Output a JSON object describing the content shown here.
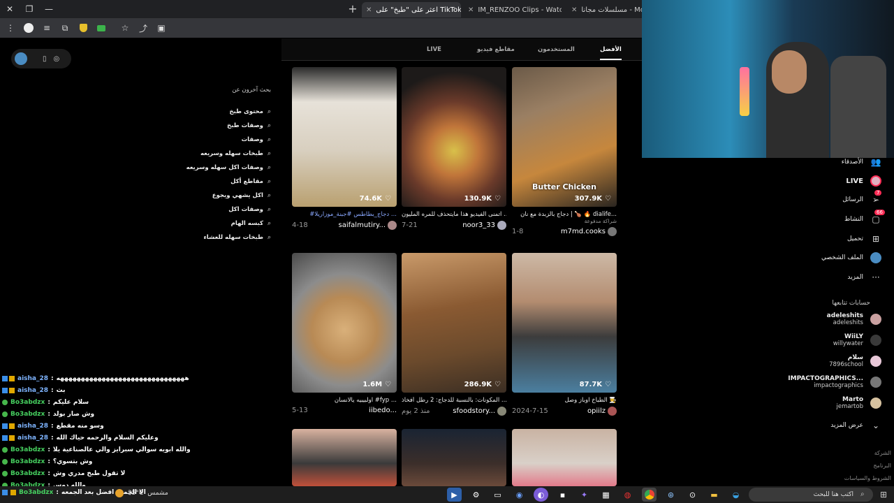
{
  "browser": {
    "tabs": [
      {
        "label": "مسلسلات مجانا - MovieBox"
      },
      {
        "label": "IM_RENZOO Clips - Watch Live"
      },
      {
        "label": "اعثر على \"طبخ\" على TikTok | بحث"
      }
    ],
    "new_tab": "+",
    "close_symbol": "✕"
  },
  "related": {
    "title": "بحث آخرون عن",
    "items": [
      "محتوى طبخ",
      "وصفات طبخ",
      "وصفات",
      "طبخات سهله وسريعه",
      "وصفات اكل سهله وسريعه",
      "مقاطع أكل",
      "اكل يشهي ويجوع",
      "وصفات اكل",
      "كبسه الهام",
      "طبخات سهله للعشاء"
    ]
  },
  "result_tabs": {
    "top": "الأفضل",
    "users": "المستخدمون",
    "videos": "مقاطع فيديو",
    "live": "LIVE"
  },
  "videos": [
    {
      "likes": "307.9K",
      "overlay": "Butter Chicken",
      "desc": "دجاج بالزبدة مع نان | 🍗 🔥 dialife...",
      "sub": "شراكة مدفوعة",
      "user": "m7md.cooks",
      "date": "1-8"
    },
    {
      "likes": "130.9K",
      "overlay": "",
      "desc": "اتمنى الفيديو هذا مايتحذف للمره المليون ...",
      "sub": "",
      "user": "noor3_33",
      "date": "7-21"
    },
    {
      "likes": "74.6K",
      "overlay": "",
      "desc": "#دجاج_بطاطس #جبنة_موزاريلا ...",
      "sub": "",
      "user": "saifalmutiry...",
      "date": "4-18"
    },
    {
      "likes": "87.7K",
      "overlay": "",
      "desc": "الطباخ اوباز وصل 🧑‍🍳",
      "sub": "",
      "user": "opiilz",
      "date": "2024-7-15"
    },
    {
      "likes": "286.9K",
      "overlay": "",
      "desc": "المكونات: بالنسبة للدجاج: 2 رطل أفخاذ ...",
      "sub": "",
      "user": "sfoodstory...",
      "date": "منذ 2 يوم"
    },
    {
      "likes": "1.6M",
      "overlay": "",
      "desc": "اولبيبيه يالانسان #fyp ...",
      "sub": "",
      "user": "iibedo...",
      "date": "5-13"
    }
  ],
  "nav": {
    "friends": "الأصدقاء",
    "live": "LIVE",
    "messages": "الرسائل",
    "messages_badge": "7",
    "activity": "النشاط",
    "activity_badge": "66",
    "upload": "تحميل",
    "profile": "الملف الشخصي",
    "more": "المزيد",
    "following_title": "حسابات تتابعها",
    "show_more": "عرض المزيد",
    "footer": [
      "الشركة",
      "البرنامج",
      "الشروط والسياسات"
    ]
  },
  "following": [
    {
      "name": "adeleshits",
      "handle": "adeleshits",
      "color": "#c9a0a0"
    },
    {
      "name": "WiiLY",
      "handle": "willywater",
      "color": "#3a3a3a"
    },
    {
      "name": "سلام",
      "handle": "7896school",
      "color": "#e8c8d8"
    },
    {
      "name": "IMPACTOGRAPHICS...",
      "handle": "impactographics",
      "color": "#777"
    },
    {
      "name": "Marto",
      "handle": "jemartob",
      "color": "#d7c2a0"
    }
  ],
  "chat": [
    {
      "user": "aisha_28",
      "msg": "هههههههههههههههههههههههههههههههه",
      "color": "#7eb4ff",
      "badge": "sub"
    },
    {
      "user": "aisha_28",
      "msg": "بث",
      "color": "#7eb4ff",
      "badge": "sub"
    },
    {
      "user": "Bo3abdzx",
      "msg": "سلام عليكم",
      "color": "#46d160",
      "badge": "vip"
    },
    {
      "user": "Bo3abdzx",
      "msg": "وش صار بولد",
      "color": "#46d160",
      "badge": "vip"
    },
    {
      "user": "aisha_28",
      "msg": "وسو منه مقطع",
      "color": "#7eb4ff",
      "badge": "sub"
    },
    {
      "user": "aisha_28",
      "msg": "وعليكم السلام والرحمه حياك الله",
      "color": "#7eb4ff",
      "badge": "sub"
    },
    {
      "user": "Bo3abdzx",
      "msg": "والله ابويه سوالي سبرايز والي عالصناعية يلا",
      "color": "#46d160",
      "badge": "vip"
    },
    {
      "user": "Bo3abdzx",
      "msg": "وش بتسوي؟",
      "color": "#46d160",
      "badge": "vip"
    },
    {
      "user": "Bo3abdzx",
      "msg": "لا تقول طبخ مدري وش",
      "color": "#46d160",
      "badge": "vip"
    },
    {
      "user": "Bo3abdzx",
      "msg": "والله دوس",
      "color": "#46d160",
      "badge": "vip"
    },
    {
      "user": "Bo3abdzx",
      "msg": "الا الجمعه افضل بعد الجمعه",
      "color": "#46d160",
      "badge": "sub"
    }
  ],
  "taskbar": {
    "weather_temp": "35°C",
    "weather_label": "مشمس",
    "search_placeholder": "اكتب هنا للبحث"
  },
  "colors": {
    "accent": "#fe2c55",
    "tag": "#8aa8ff",
    "chat_green": "#46d160",
    "chat_blue": "#7eb4ff"
  }
}
